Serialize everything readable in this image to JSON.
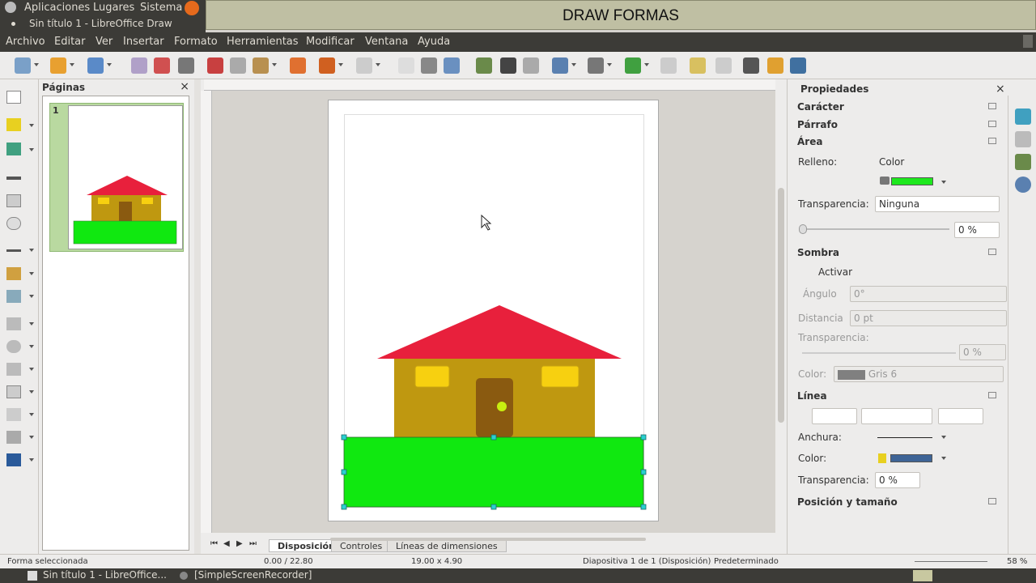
{
  "top_panel": {
    "applications": "Aplicaciones",
    "places": "Lugares",
    "system": "Sistema",
    "window_title": "Sin título 1 - LibreOffice Draw"
  },
  "banner": {
    "text": "DRAW FORMAS"
  },
  "menu": {
    "items": [
      "Archivo",
      "Editar",
      "Ver",
      "Insertar",
      "Formato",
      "Herramientas",
      "Modificar",
      "Ventana",
      "Ayuda"
    ]
  },
  "pages_panel": {
    "title": "Páginas",
    "close": "×",
    "page_number": "1"
  },
  "page_tabs": {
    "items": [
      "Disposición",
      "Controles",
      "Líneas de dimensiones"
    ],
    "active": "Disposición"
  },
  "properties": {
    "title": "Propiedades",
    "close": "×",
    "sections": {
      "character": "Carácter",
      "paragraph": "Párrafo",
      "area": "Área",
      "shadow": "Sombra",
      "line": "Línea",
      "position_size": "Posición y tamaño"
    },
    "area": {
      "fill_label": "Relleno:",
      "fill_value": "Color",
      "fill_color": "#1ee81e",
      "transparency_label": "Transparencia:",
      "transparency_value": "Ninguna",
      "transparency_percent": "0 %"
    },
    "shadow": {
      "activate": "Activar",
      "angle_label": "Ángulo",
      "angle_value": "0°",
      "distance_label": "Distancia",
      "distance_value": "0 pt",
      "transparency_label": "Transparencia:",
      "transparency_value": "0 %",
      "color_label": "Color:",
      "color_value": "Gris 6",
      "color_swatch": "#808080"
    },
    "line": {
      "width_label": "Anchura:",
      "color_label": "Color:",
      "color_swatch": "#3e6496",
      "transparency_label": "Transparencia:",
      "transparency_value": "0 %"
    }
  },
  "status": {
    "selection": "Forma seleccionada",
    "position": "0.00 / 22.80",
    "size": "19.00 x 4.90",
    "slide": "Diapositiva 1 de 1 (Disposición)",
    "master": "Predeterminado",
    "zoom": "58 %"
  },
  "taskbar": {
    "item1": "Sin título 1 - LibreOffice...",
    "item2": "[SimpleScreenRecorder]"
  },
  "colors": {
    "roof": "#e8203c",
    "wall": "#bf9810",
    "window": "#f7d010",
    "door": "#8a5a10",
    "knob": "#c8ee10",
    "grass": "#10e810",
    "handle": "#2ad0d0"
  }
}
